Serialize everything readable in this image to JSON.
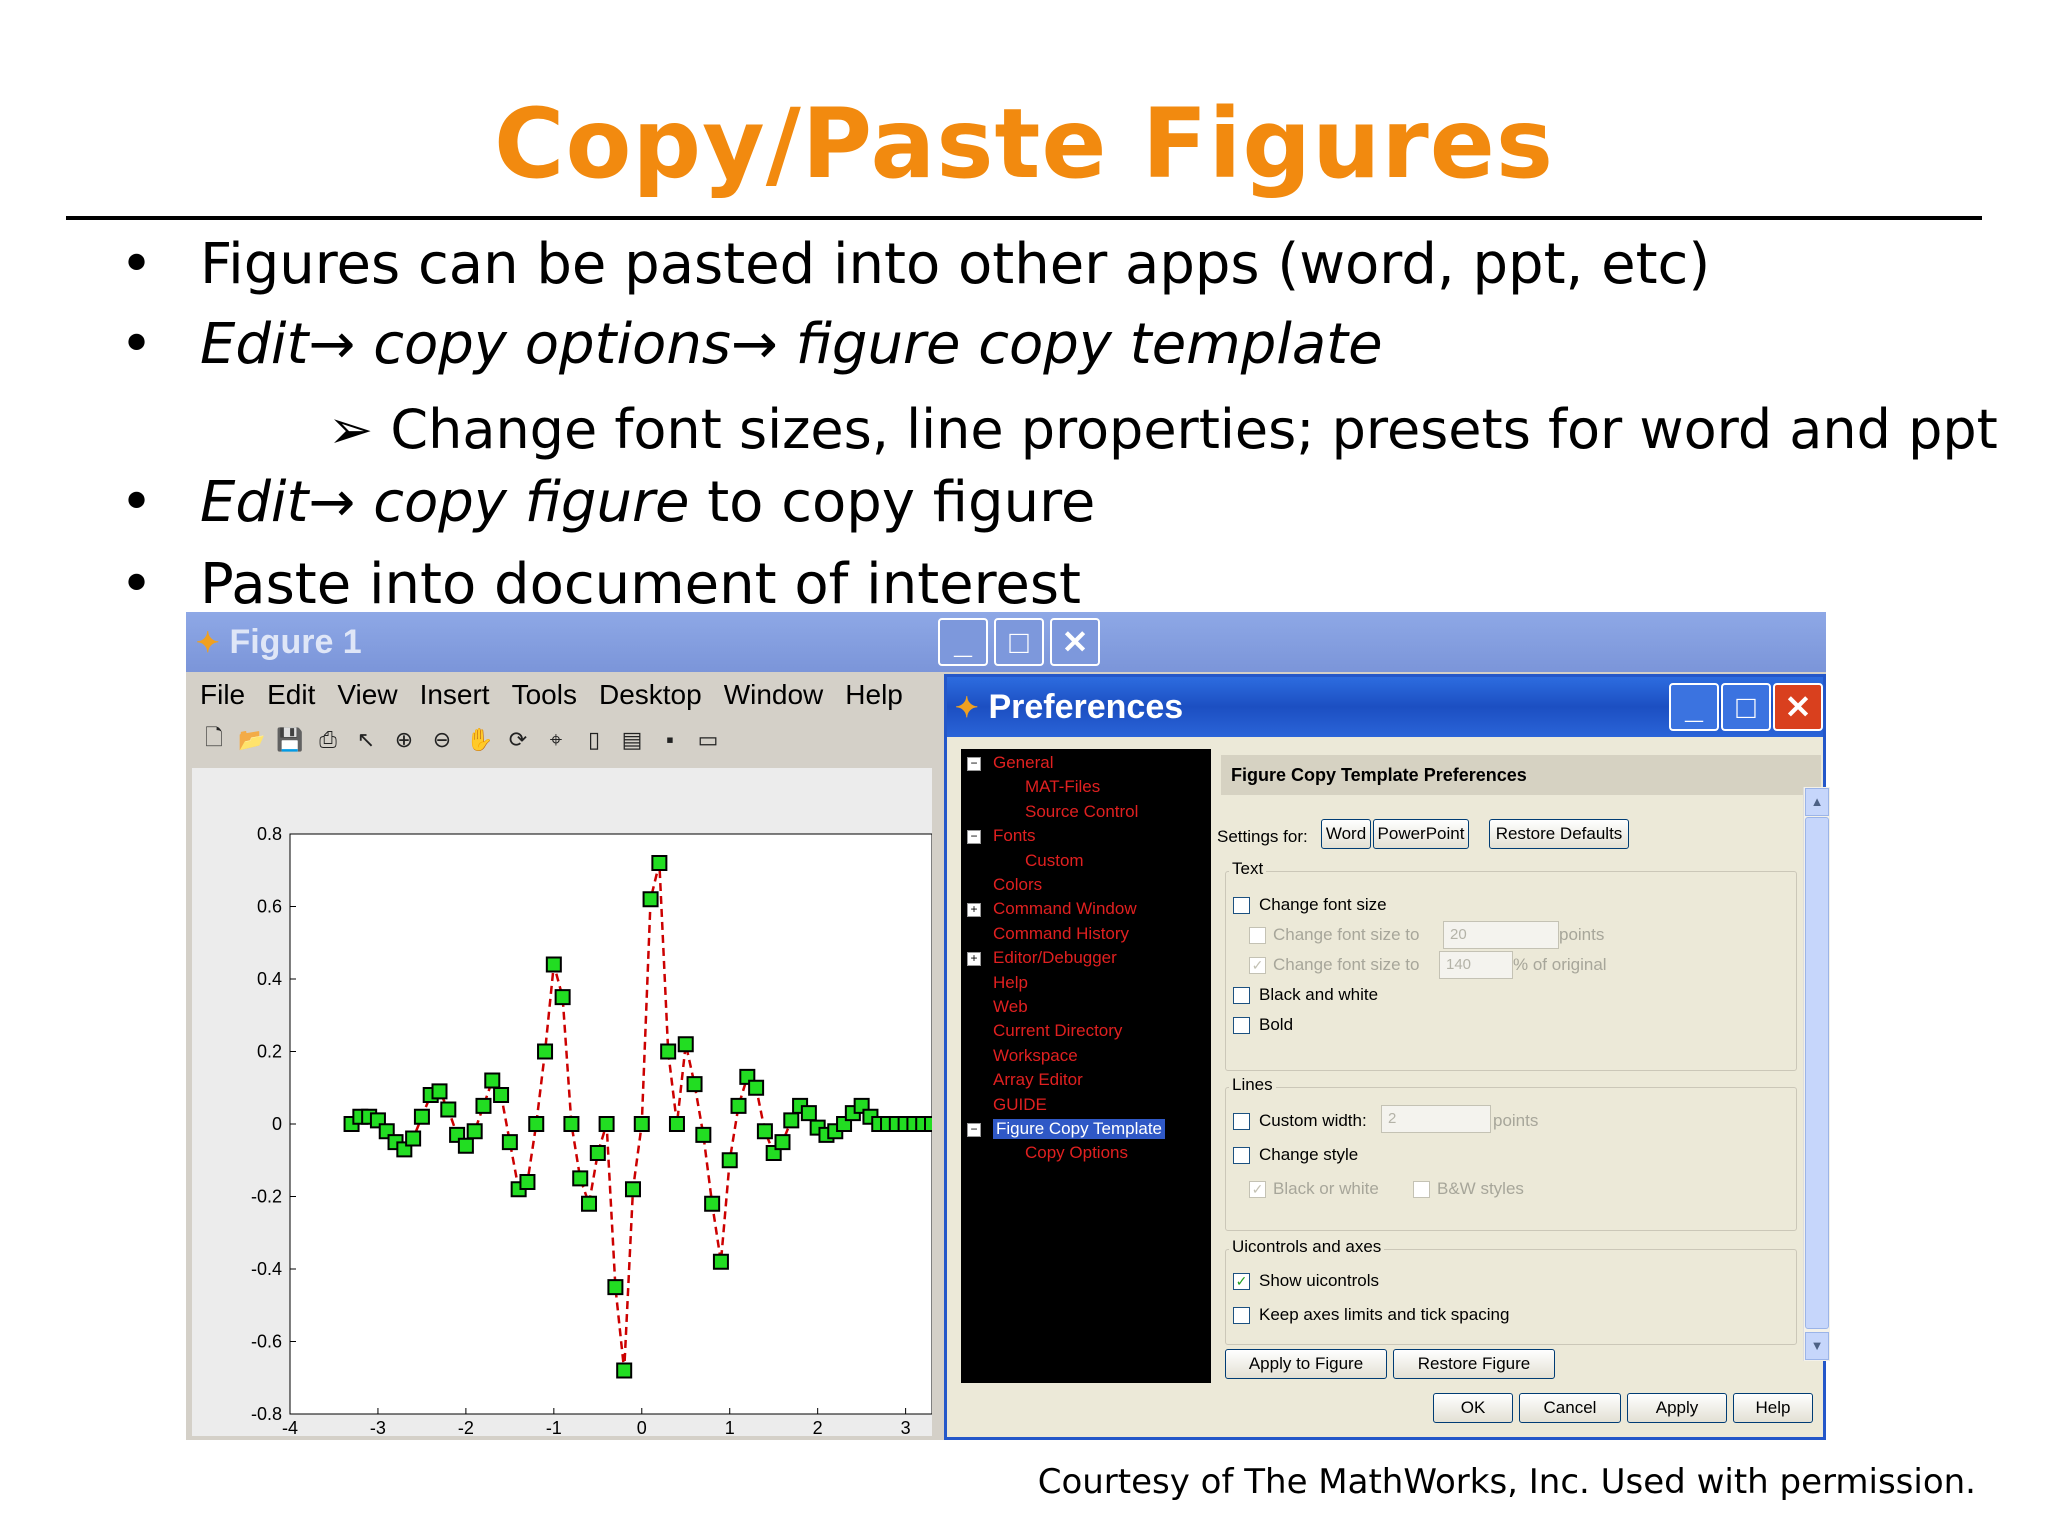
{
  "slide": {
    "title": "Copy/Paste Figures",
    "bullets": [
      "Figures can be pasted into other apps (word, ppt, etc)",
      "Edit→ copy options→ figure copy template",
      "Edit→ copy figure to copy figure",
      "Paste into document of interest"
    ],
    "bullet2_parts": [
      "Edit",
      "→ ",
      "copy options",
      "→ ",
      "figure copy template"
    ],
    "bullet3_parts": [
      "Edit",
      "→ ",
      "copy figure",
      " to copy figure"
    ],
    "subbullet": "Change font sizes, line properties; presets for word and ppt",
    "courtesy": "Courtesy of The MathWorks, Inc. Used with permission."
  },
  "figure_window": {
    "title": "Figure 1",
    "menu": [
      "File",
      "Edit",
      "View",
      "Insert",
      "Tools",
      "Desktop",
      "Window",
      "Help"
    ],
    "toolbar_icons": [
      "new-icon",
      "open-icon",
      "save-icon",
      "print-icon",
      "pointer-icon",
      "zoom-in-icon",
      "zoom-out-icon",
      "pan-icon",
      "rotate-icon",
      "data-cursor-icon",
      "colorbar-icon",
      "legend-icon",
      "hide-tools-icon",
      "show-tools-icon"
    ]
  },
  "chart_data": {
    "type": "line",
    "xlim": [
      -4,
      3.3
    ],
    "ylim": [
      -0.8,
      0.8
    ],
    "xticks": [
      "-4",
      "-3",
      "-2",
      "-1",
      "0",
      "1",
      "2",
      "3"
    ],
    "yticks": [
      "0.8",
      "0.6",
      "0.4",
      "0.2",
      "0",
      "-0.2",
      "-0.4",
      "-0.6",
      "-0.8"
    ],
    "series": [
      {
        "style": "dashed line with square markers",
        "line_color": "#cc0000",
        "marker_color": "#22dd22",
        "marker_edge": "#000000",
        "x": [
          -3.3,
          -3.2,
          -3.1,
          -3.0,
          -2.9,
          -2.8,
          -2.7,
          -2.6,
          -2.5,
          -2.4,
          -2.3,
          -2.2,
          -2.1,
          -2.0,
          -1.9,
          -1.8,
          -1.7,
          -1.6,
          -1.5,
          -1.4,
          -1.3,
          -1.2,
          -1.1,
          -1.0,
          -0.9,
          -0.8,
          -0.7,
          -0.6,
          -0.5,
          -0.4,
          -0.3,
          -0.2,
          -0.1,
          0.0,
          0.1,
          0.2,
          0.3,
          0.4,
          0.5,
          0.6,
          0.7,
          0.8,
          0.9,
          1.0,
          1.1,
          1.2,
          1.3,
          1.4,
          1.5,
          1.6,
          1.7,
          1.8,
          1.9,
          2.0,
          2.1,
          2.2,
          2.3,
          2.4,
          2.5,
          2.6,
          2.7,
          2.8,
          2.9,
          3.0,
          3.1,
          3.2,
          3.3
        ],
        "y": [
          0.0,
          0.02,
          0.02,
          0.01,
          -0.02,
          -0.05,
          -0.07,
          -0.04,
          0.02,
          0.08,
          0.09,
          0.04,
          -0.03,
          -0.06,
          -0.02,
          0.05,
          0.12,
          0.08,
          -0.05,
          -0.18,
          -0.16,
          0.0,
          0.2,
          0.44,
          0.35,
          0.0,
          -0.15,
          -0.22,
          -0.08,
          0.0,
          -0.45,
          -0.68,
          -0.18,
          0.0,
          0.62,
          0.72,
          0.2,
          0.0,
          0.22,
          0.11,
          -0.03,
          -0.22,
          -0.38,
          -0.1,
          0.05,
          0.13,
          0.1,
          -0.02,
          -0.08,
          -0.05,
          0.01,
          0.05,
          0.03,
          -0.01,
          -0.03,
          -0.02,
          0.0,
          0.03,
          0.05,
          0.02,
          0.0,
          0.0,
          0.0,
          0.0,
          0.0,
          0.0,
          0.0
        ]
      }
    ]
  },
  "preferences": {
    "title": "Preferences",
    "tree": [
      {
        "label": "General",
        "level": 0,
        "box": "−"
      },
      {
        "label": "MAT-Files",
        "level": 1
      },
      {
        "label": "Source Control",
        "level": 1
      },
      {
        "label": "Fonts",
        "level": 0,
        "box": "−"
      },
      {
        "label": "Custom",
        "level": 1
      },
      {
        "label": "Colors",
        "level": 0
      },
      {
        "label": "Command Window",
        "level": 0,
        "box": "+"
      },
      {
        "label": "Command History",
        "level": 0
      },
      {
        "label": "Editor/Debugger",
        "level": 0,
        "box": "+"
      },
      {
        "label": "Help",
        "level": 0
      },
      {
        "label": "Web",
        "level": 0
      },
      {
        "label": "Current Directory",
        "level": 0
      },
      {
        "label": "Workspace",
        "level": 0
      },
      {
        "label": "Array Editor",
        "level": 0
      },
      {
        "label": "GUIDE",
        "level": 0
      },
      {
        "label": "Figure Copy Template",
        "level": 0,
        "box": "−",
        "selected": true
      },
      {
        "label": "Copy Options",
        "level": 1
      }
    ],
    "panel_title": "Figure Copy Template Preferences",
    "settings_for": "Settings for:",
    "btn_word": "Word",
    "btn_ppt": "PowerPoint",
    "btn_restore_defaults": "Restore Defaults",
    "text_group": "Text",
    "change_font_size": "Change font size",
    "change_font_size_to": "Change font size to",
    "font_size_value": "20",
    "points": "points",
    "change_font_size_to2": "Change font size to",
    "percent_value": "140",
    "pct_original": "% of original",
    "black_and_white": "Black and white",
    "bold": "Bold",
    "lines_group": "Lines",
    "custom_width": "Custom width:",
    "custom_width_value": "2",
    "points2": "points",
    "change_style": "Change style",
    "black_or_white": "Black or white",
    "bw_styles": "B&W styles",
    "uicontrols_group": "Uicontrols and axes",
    "show_uicontrols": "Show uicontrols",
    "keep_axes": "Keep axes limits and tick spacing",
    "apply_to_figure": "Apply to Figure",
    "restore_figure": "Restore Figure",
    "ok": "OK",
    "cancel": "Cancel",
    "apply": "Apply",
    "help": "Help"
  }
}
